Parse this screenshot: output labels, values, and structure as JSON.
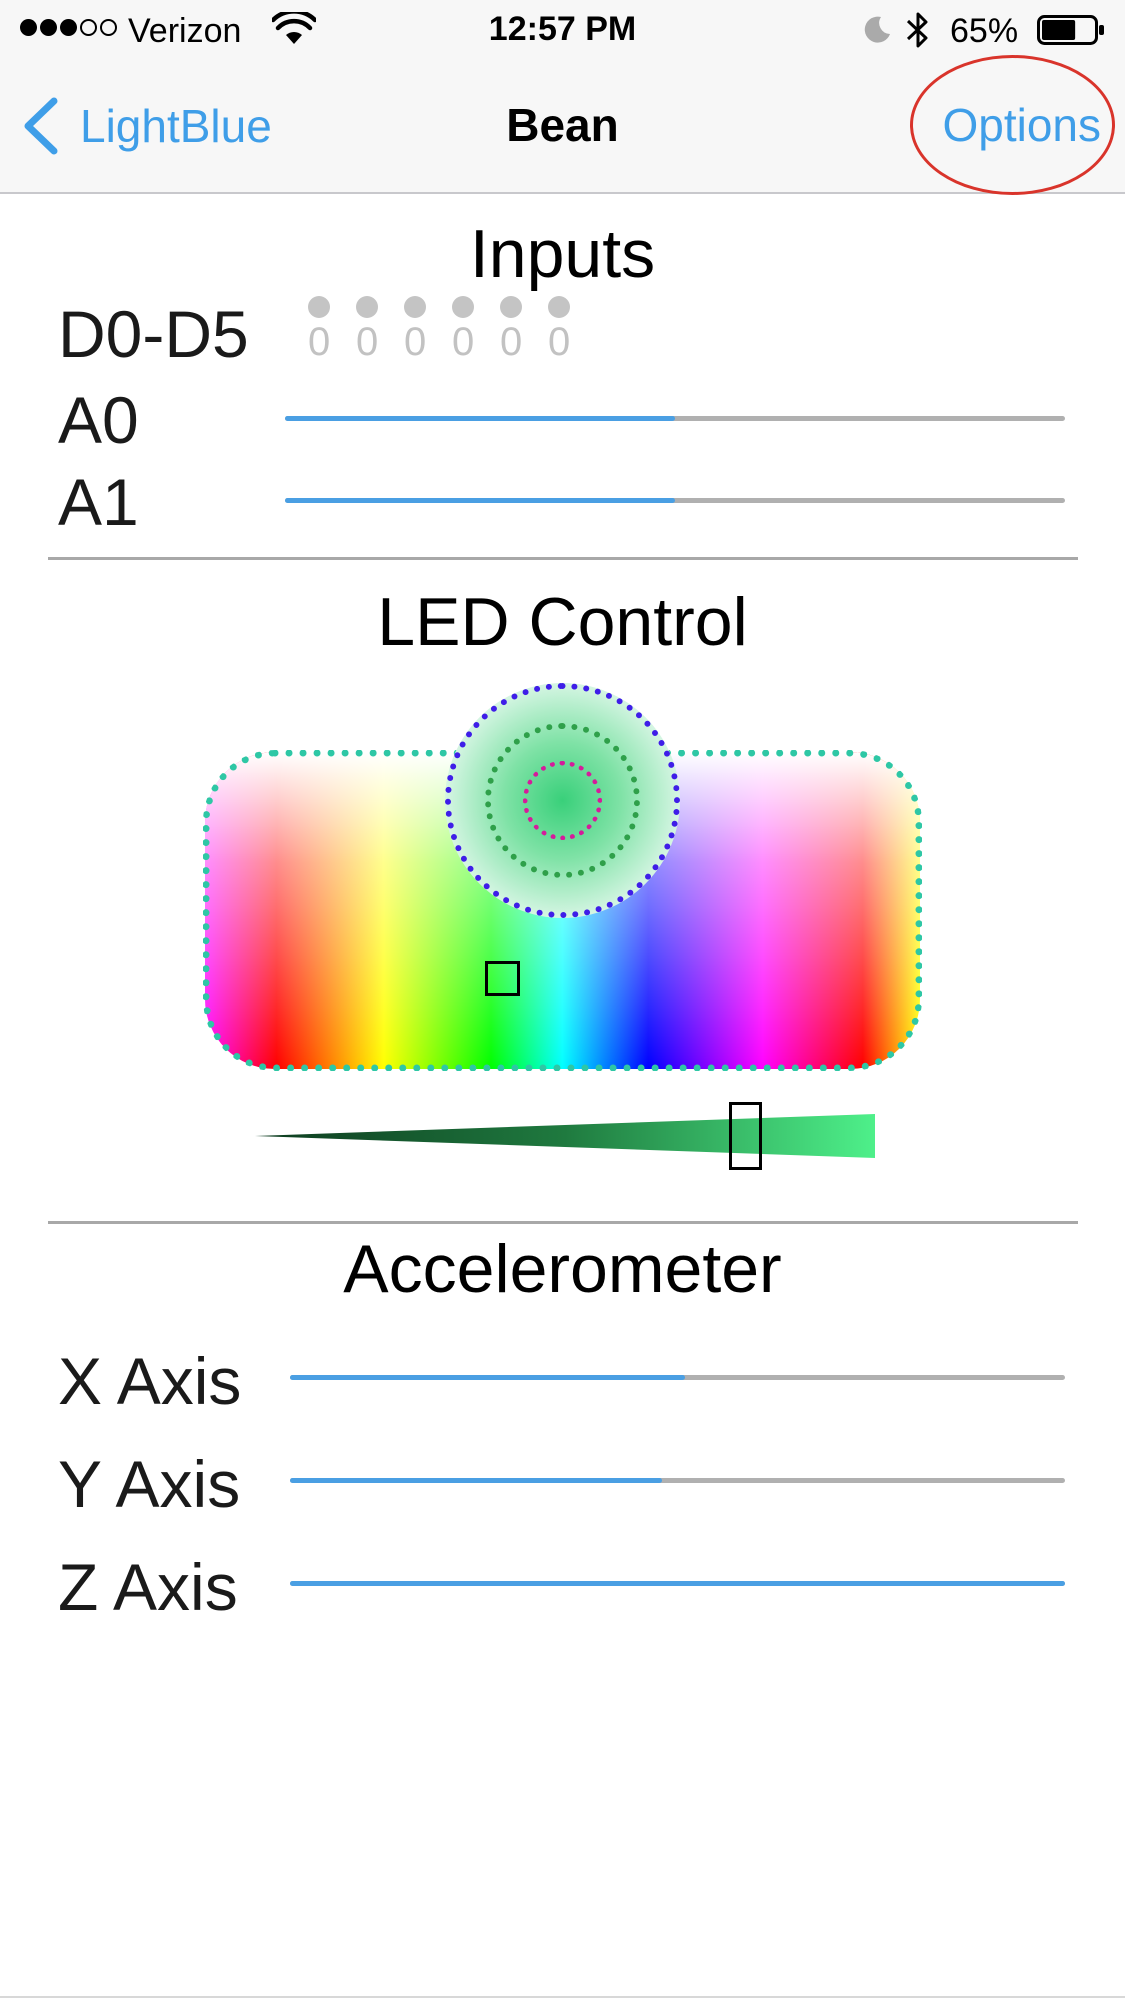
{
  "status_bar": {
    "signal_bars": 3,
    "signal_max": 5,
    "carrier": "Verizon",
    "time": "12:57 PM",
    "battery_percent": "65%",
    "battery_level": 0.65,
    "icons": [
      "wifi-icon",
      "moon-icon",
      "bluetooth-icon",
      "battery-icon"
    ]
  },
  "nav": {
    "back_label": "LightBlue",
    "title": "Bean",
    "options_label": "Options",
    "annotation_color": "#d9342b"
  },
  "inputs": {
    "title": "Inputs",
    "digital_label": "D0-D5",
    "digital_values": [
      "0",
      "0",
      "0",
      "0",
      "0",
      "0"
    ],
    "analog": [
      {
        "label": "A0",
        "level": 0.5
      },
      {
        "label": "A1",
        "level": 0.5
      }
    ]
  },
  "led_control": {
    "title": "LED Control",
    "selected_color": "#39d07a",
    "brightness_level": 0.79
  },
  "accelerometer": {
    "title": "Accelerometer",
    "axes": [
      {
        "label": "X Axis",
        "level": 0.51
      },
      {
        "label": "Y Axis",
        "level": 0.48
      },
      {
        "label": "Z Axis",
        "level": 1.0
      }
    ]
  },
  "colors": {
    "accent": "#3f9ee8",
    "track_fill": "#4a9fe3",
    "track_bg": "#b0b0b0"
  }
}
